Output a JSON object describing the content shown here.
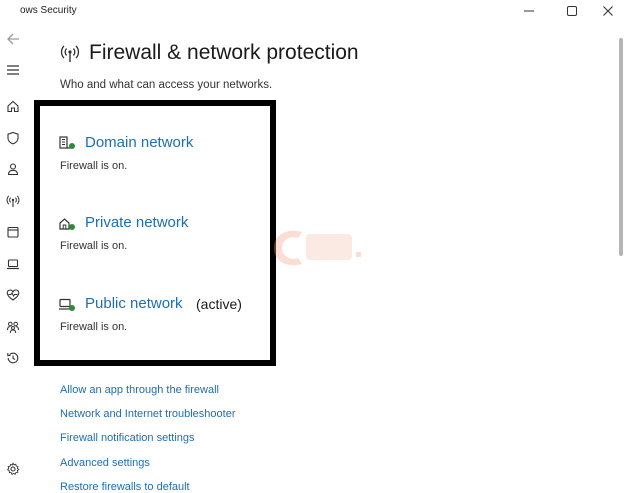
{
  "window": {
    "title": "ows Security",
    "minimize_icon": "minimize-icon",
    "maximize_icon": "maximize-icon",
    "close_icon": "close-icon"
  },
  "rail": {
    "items": [
      {
        "icon": "back-arrow-icon"
      },
      {
        "icon": "hamburger-menu-icon"
      },
      {
        "icon": "home-icon"
      },
      {
        "icon": "shield-icon"
      },
      {
        "icon": "person-icon"
      },
      {
        "icon": "wireless-antenna-icon"
      },
      {
        "icon": "app-browser-icon"
      },
      {
        "icon": "laptop-icon"
      },
      {
        "icon": "heart-pulse-icon"
      },
      {
        "icon": "family-icon"
      },
      {
        "icon": "history-icon"
      },
      {
        "icon": "settings-gear-icon"
      }
    ]
  },
  "header": {
    "icon": "wireless-antenna-icon",
    "title": "Firewall & network protection",
    "subtitle": "Who and what can access your networks."
  },
  "networks": [
    {
      "icon": "domain-network-icon",
      "name": "Domain network",
      "active": "",
      "status": "Firewall is on."
    },
    {
      "icon": "private-network-icon",
      "name": "Private network",
      "active": "",
      "status": "Firewall is on."
    },
    {
      "icon": "public-network-icon",
      "name": "Public network",
      "active": "(active)",
      "status": "Firewall is on."
    }
  ],
  "links": [
    "Allow an app through the firewall",
    "Network and Internet troubleshooter",
    "Firewall notification settings",
    "Advanced settings",
    "Restore firewalls to default"
  ],
  "colors": {
    "link": "#1c6fb5",
    "highlight_border": "#000000",
    "status_dot": "#2e8b3e"
  }
}
